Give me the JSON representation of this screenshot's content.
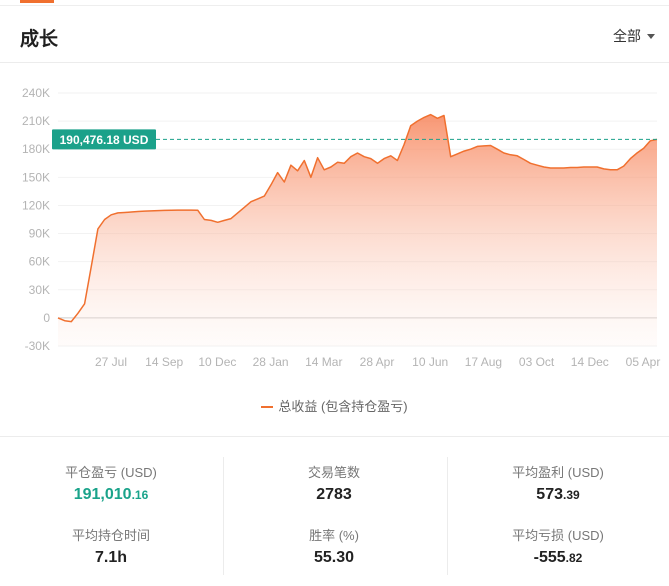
{
  "header": {
    "title": "成长",
    "filter_label": "全部"
  },
  "chart_data": {
    "type": "area",
    "y_ticks": [
      "240K",
      "210K",
      "180K",
      "150K",
      "120K",
      "90K",
      "60K",
      "30K",
      "0",
      "-30K"
    ],
    "x_ticks": [
      "27 Jul",
      "14 Sep",
      "10 Dec",
      "28 Jan",
      "14 Mar",
      "28 Apr",
      "10 Jun",
      "17 Aug",
      "03 Oct",
      "14 Dec",
      "05 Apr"
    ],
    "ylim": [
      -30000,
      240000
    ],
    "current_label": "190,476.18 USD",
    "current_value": 190476.18,
    "legend": [
      "总收益 (包含持仓盈亏)"
    ],
    "series": [
      {
        "name": "总收益 (包含持仓盈亏)",
        "values": [
          0,
          -3000,
          -4000,
          5000,
          15000,
          55000,
          95000,
          105000,
          110000,
          112000,
          112500,
          113000,
          113500,
          114000,
          114200,
          114500,
          114700,
          114900,
          115000,
          115000,
          115000,
          114800,
          105000,
          104000,
          102000,
          104000,
          106000,
          112000,
          118000,
          124000,
          127000,
          130000,
          142000,
          155000,
          145000,
          163000,
          157000,
          168000,
          150000,
          171000,
          158000,
          161000,
          166000,
          165000,
          172000,
          176000,
          172000,
          170000,
          165000,
          170000,
          173000,
          168000,
          185000,
          205000,
          210000,
          214000,
          217000,
          213000,
          216000,
          172000,
          175000,
          178000,
          180000,
          183000,
          183500,
          184000,
          180000,
          176000,
          174000,
          173000,
          169000,
          165000,
          163000,
          161000,
          160000,
          160000,
          160000,
          160500,
          160500,
          161000,
          161000,
          161000,
          159000,
          158000,
          158000,
          162000,
          170000,
          176000,
          181000,
          189000,
          190476
        ]
      }
    ],
    "line_color": "#f0702f",
    "label_color": "#1ba18a"
  },
  "stats": [
    [
      {
        "label": "平仓盈亏 (USD)",
        "main": "191,010",
        "small": ".16",
        "tone": "green"
      },
      {
        "label": "平均持仓时间",
        "main": "7.1h",
        "small": "",
        "tone": ""
      }
    ],
    [
      {
        "label": "交易笔数",
        "main": "2783",
        "small": "",
        "tone": ""
      },
      {
        "label": "胜率 (%)",
        "main": "55.30",
        "small": "",
        "tone": ""
      }
    ],
    [
      {
        "label": "平均盈利 (USD)",
        "main": "573",
        "small": ".39",
        "tone": ""
      },
      {
        "label": "平均亏损 (USD)",
        "main": "-555",
        "small": ".82",
        "tone": ""
      }
    ]
  ]
}
